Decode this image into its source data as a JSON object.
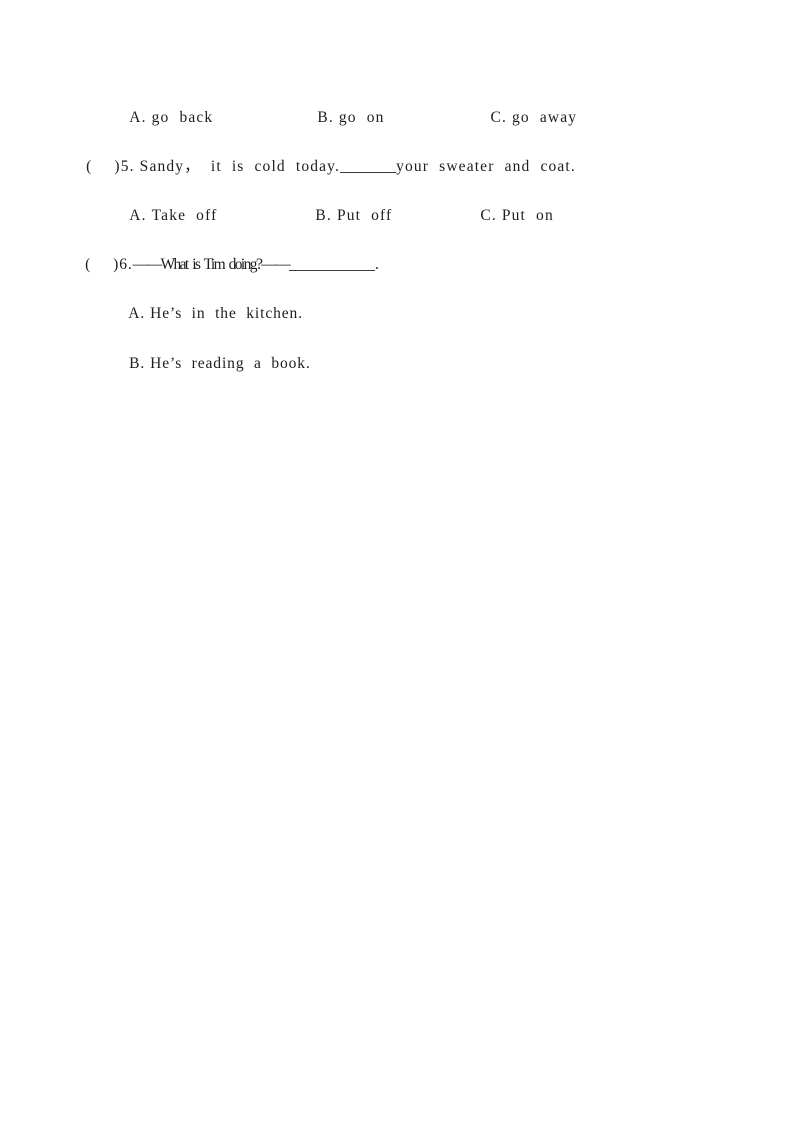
{
  "document": {
    "type": "english-exam-worksheet",
    "page_background": "#ffffff",
    "text_color": "#1d1d1d"
  },
  "lines": {
    "q4_options": {
      "a_label": "A.",
      "a_text": "go  back",
      "b_label": "B.",
      "b_text": "go  on",
      "c_label": "C.",
      "c_text": "go  away"
    },
    "q5": {
      "bracket_open": "(",
      "bracket_close": ")",
      "number": "5.",
      "text_before_blank": "Sandy，  it  is  cold  today.",
      "text_after_blank": "your  sweater  and  coat."
    },
    "q5_options": {
      "a_label": "A.",
      "a_text": "Take  off",
      "b_label": "B.",
      "b_text": "Put  off",
      "c_label": "C.",
      "c_text": "Put  on"
    },
    "q6": {
      "bracket_open": "(",
      "bracket_close": ")",
      "number": "6.",
      "text_before_blank": "——What  is  Tim  doing?——",
      "text_after_blank": "."
    },
    "q6_answers": {
      "a_label": "A.",
      "a_text": "He’s  in  the  kitchen.",
      "b_label": "B.",
      "b_text": "He’s  reading  a  book."
    }
  }
}
